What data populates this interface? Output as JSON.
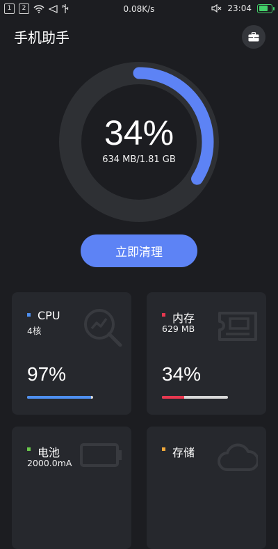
{
  "status_bar": {
    "sim1": "1",
    "sim2": "2",
    "net_speed": "0.08K/s",
    "time": "23:04"
  },
  "header": {
    "title": "手机助手",
    "toolbox_icon": "toolbox-icon"
  },
  "memory_ring": {
    "percent_text": "34%",
    "percent": 0.34,
    "usage_text": "634 MB/1.81 GB",
    "track_color": "#2e3034",
    "fill_color": "#5d83f5"
  },
  "clean_button": {
    "label": "立即清理"
  },
  "cards": {
    "cpu": {
      "label": "CPU",
      "sub": "4核",
      "value": "97%",
      "level": 0.97,
      "dot_color": "#4e8ff0",
      "bar_color": "#4e8ff0",
      "icon": "chart-search-icon"
    },
    "memory": {
      "label": "内存",
      "sub": "629 MB",
      "value": "34%",
      "level": 0.34,
      "dot_color": "#e8384f",
      "bar_color": "#e8384f",
      "icon": "memory-card-icon"
    },
    "battery": {
      "label": "电池",
      "sub": "2000.0mA",
      "dot_color": "#6ac94b",
      "icon": "battery-icon"
    },
    "storage": {
      "label": "存储",
      "dot_color": "#f2a93b",
      "icon": "cloud-icon"
    }
  }
}
